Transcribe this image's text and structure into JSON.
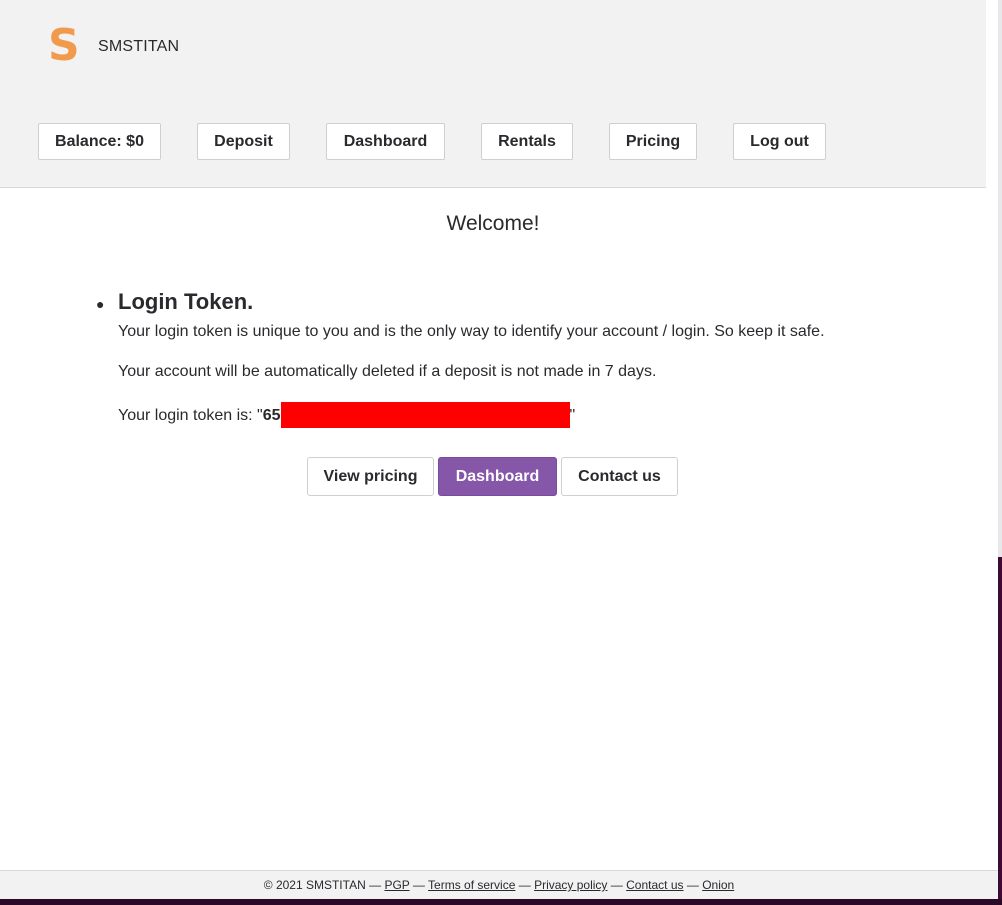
{
  "header": {
    "logo_glyph": "S",
    "brand": "SMSTITAN",
    "nav": [
      {
        "label": "Balance: $0"
      },
      {
        "label": "Deposit"
      },
      {
        "label": "Dashboard"
      },
      {
        "label": "Rentals"
      },
      {
        "label": "Pricing"
      },
      {
        "label": "Log out"
      }
    ]
  },
  "main": {
    "welcome": "Welcome!",
    "section_title": "Login Token.",
    "para1": "Your login token is unique to you and is the only way to identify your account / login. So keep it safe.",
    "para2": "Your account will be automatically deleted if a deposit is not made in 7 days.",
    "token_prefix_text": "Your login token is: \"",
    "token_visible": "65",
    "token_suffix_text": "\"",
    "actions": {
      "view_pricing": "View pricing",
      "dashboard": "Dashboard",
      "contact": "Contact us"
    }
  },
  "footer": {
    "copyright": "© 2021 SMSTITAN —",
    "links": [
      "PGP",
      "Terms of service",
      "Privacy policy",
      "Contact us",
      "Onion"
    ],
    "separator": "—"
  },
  "colors": {
    "accent_purple": "#8656a8",
    "logo_orange": "#f29a4c",
    "redaction_red": "#ff0000"
  }
}
